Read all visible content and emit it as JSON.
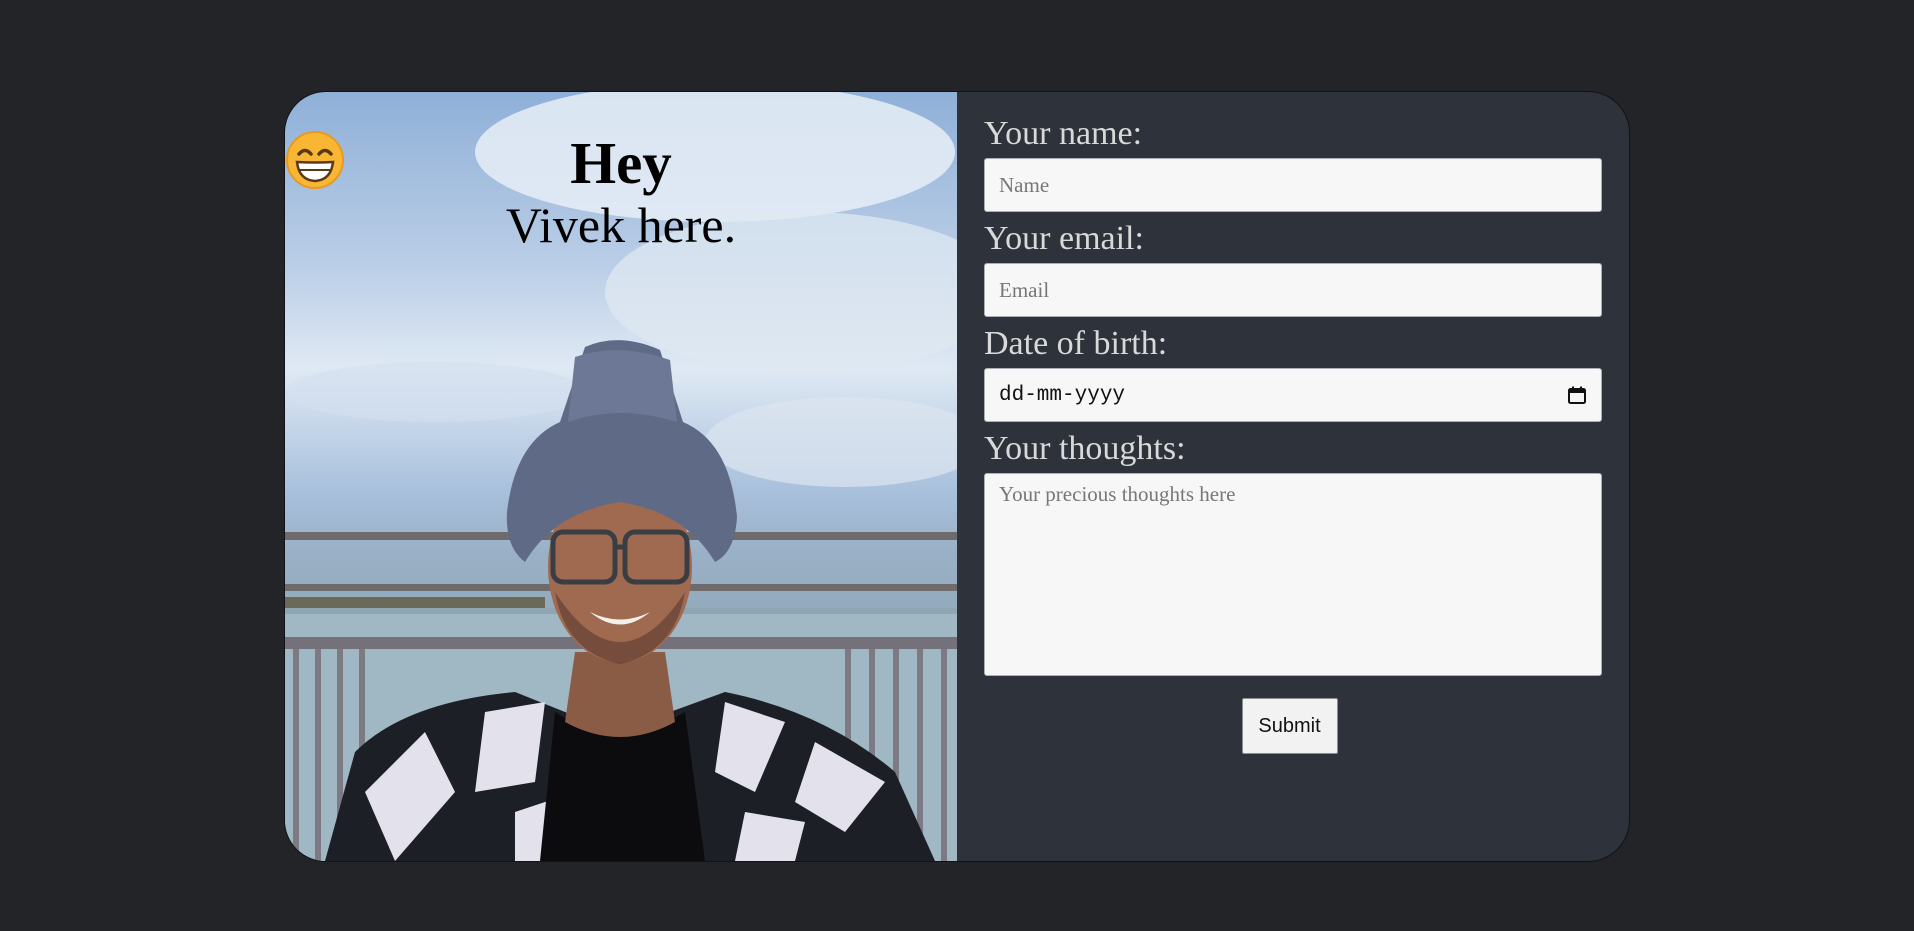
{
  "hero": {
    "greeting": "Hey",
    "emoji_icon": "grinning-face-icon",
    "subtitle": "Vivek here."
  },
  "form": {
    "name_label": "Your name:",
    "name_placeholder": "Name",
    "email_label": "Your email:",
    "email_placeholder": "Email",
    "dob_label": "Date of birth:",
    "dob_placeholder": "dd-mm-yyyy",
    "thoughts_label": "Your thoughts:",
    "thoughts_placeholder": "Your precious thoughts here",
    "submit_label": "Submit"
  },
  "colors": {
    "page_bg": "#222428",
    "form_bg": "#2e333b",
    "input_bg": "#f7f7f7"
  }
}
